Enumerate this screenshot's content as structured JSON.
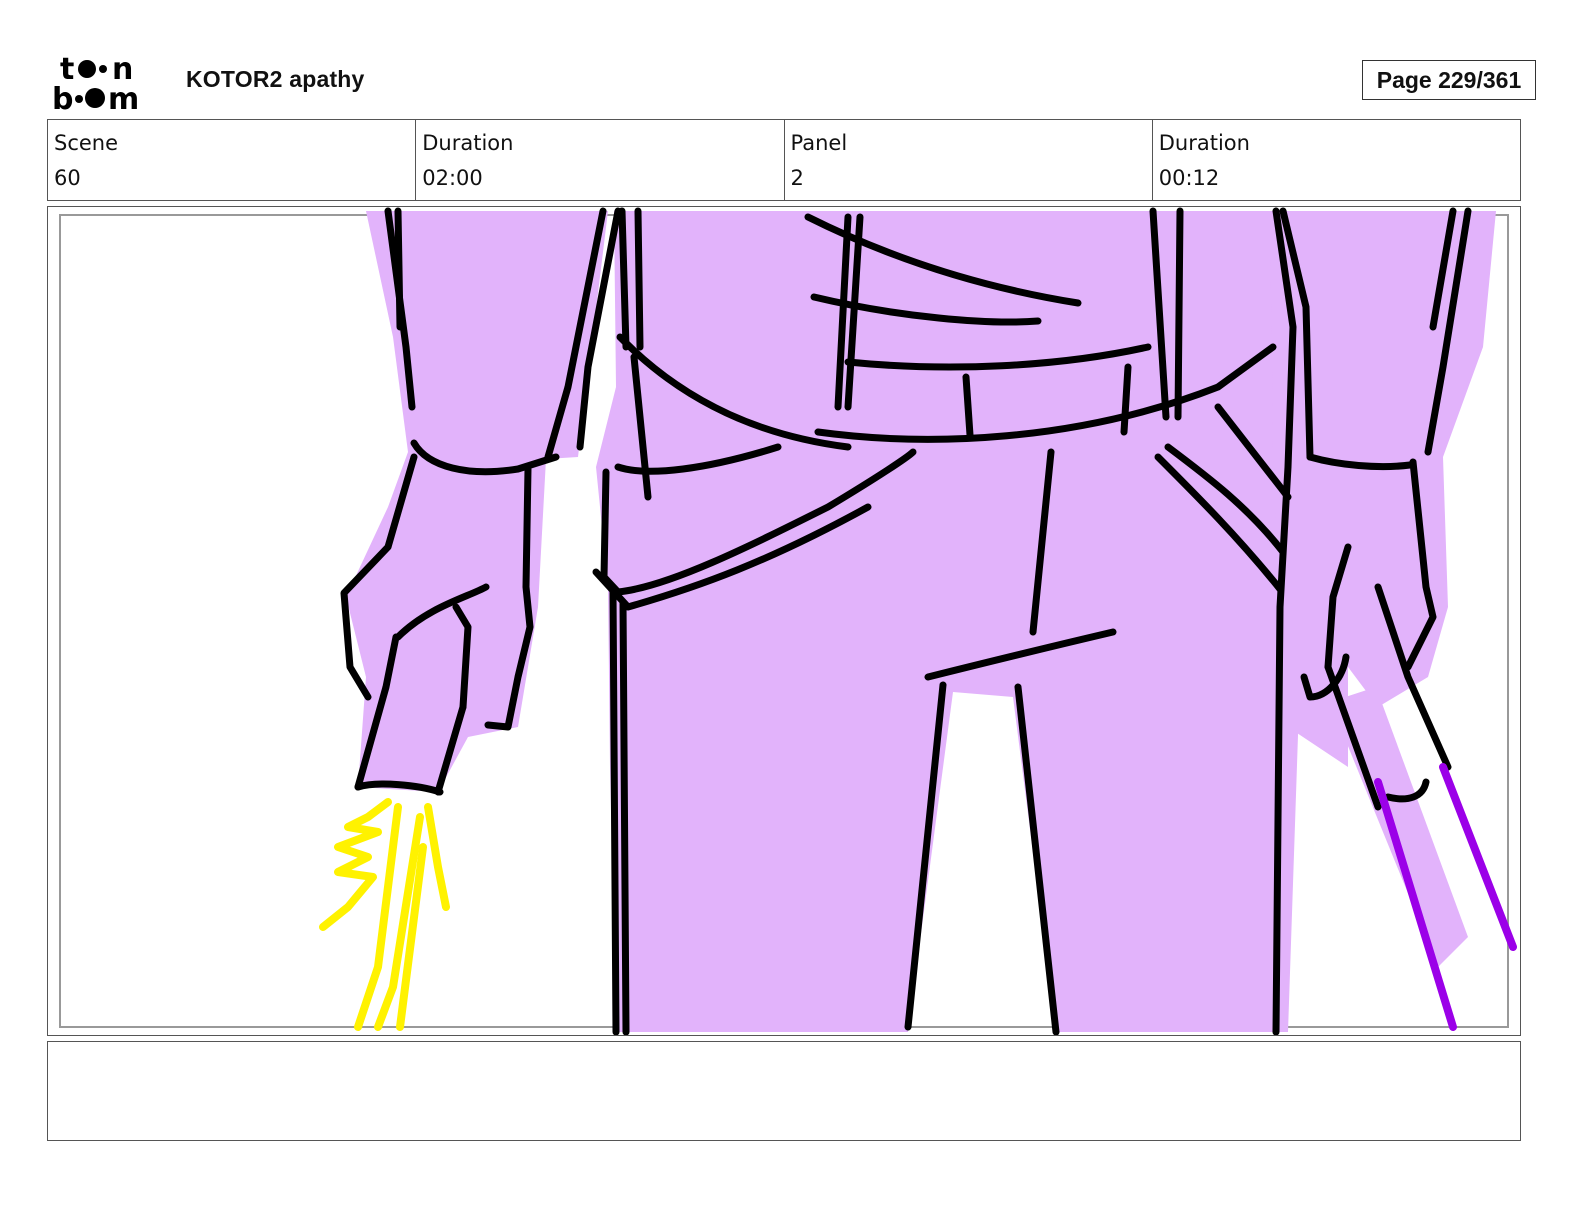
{
  "header": {
    "logo_text": "toonboom",
    "project_title": "KOTOR2 apathy",
    "page_label": "Page 229/361"
  },
  "info": {
    "scene_label": "Scene",
    "scene_value": "60",
    "scene_duration_label": "Duration",
    "scene_duration_value": "02:00",
    "panel_label": "Panel",
    "panel_value": "2",
    "panel_duration_label": "Duration",
    "panel_duration_value": "00:12"
  },
  "colors": {
    "fill": "#e2b3fb",
    "ink": "#000000",
    "yellow_effect": "#fff200",
    "purple_blade": "#9b00e8"
  },
  "notes": {
    "text": ""
  }
}
